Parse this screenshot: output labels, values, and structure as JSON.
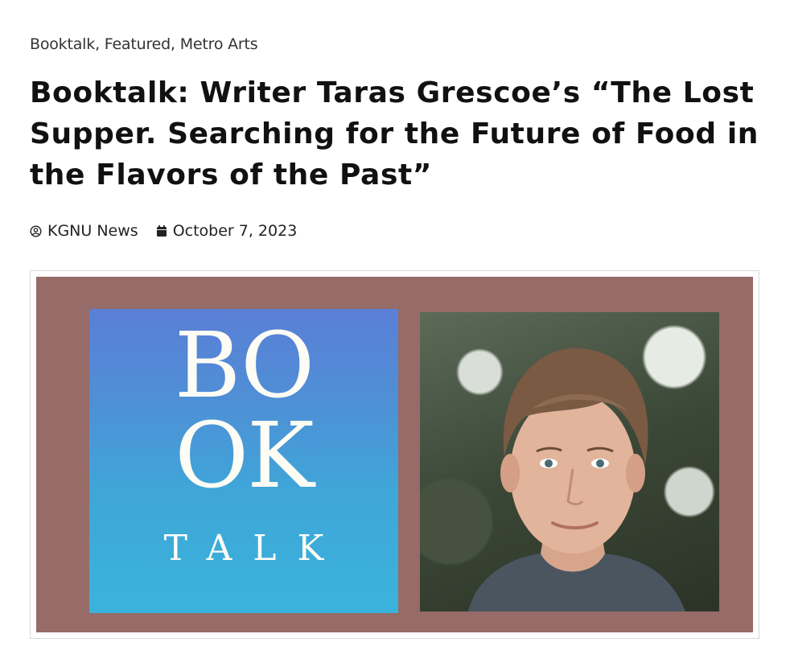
{
  "categories": {
    "items": [
      "Booktalk",
      "Featured",
      "Metro Arts"
    ],
    "separator": ", "
  },
  "post": {
    "title": "Booktalk: Writer Taras Grescoe’s “The Lost Supper. Searching for the Future of Food in the Flavors of the Past”",
    "author": "KGNU News",
    "date": "October 7, 2023"
  },
  "featured_image": {
    "logo_line1": "BO",
    "logo_line2": "OK",
    "logo_line3": "TALK"
  },
  "icons": {
    "author": "user-circle-icon",
    "date": "calendar-icon"
  },
  "colors": {
    "frame": "#966b68",
    "text": "#111111",
    "logo_top": "#5a7fd6",
    "logo_bottom": "#3ab3dc"
  }
}
